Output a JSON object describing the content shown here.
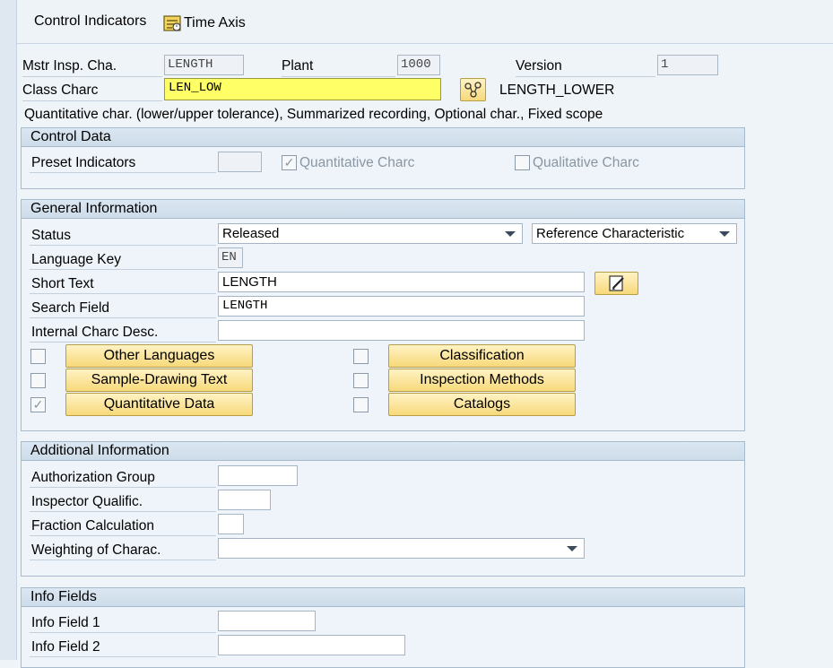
{
  "toolbar": {
    "control_indicators": "Control Indicators",
    "time_axis": "Time Axis"
  },
  "header": {
    "mstr_label": "Mstr Insp. Cha.",
    "mstr_value": "LENGTH",
    "plant_label": "Plant",
    "plant_value": "1000",
    "version_label": "Version",
    "version_value": "1",
    "class_label": "Class Charc",
    "class_value": "LEN_LOW",
    "class_desc": "LENGTH_LOWER",
    "summary": "Quantitative char. (lower/upper tolerance), Summarized recording, Optional char., Fixed scope"
  },
  "control_data": {
    "title": "Control Data",
    "preset_label": "Preset Indicators",
    "preset_value": "",
    "quant_label": "Quantitative Charc",
    "quant_checked": true,
    "qual_label": "Qualitative Charc",
    "qual_checked": false
  },
  "general": {
    "title": "General Information",
    "status_label": "Status",
    "status_value": "Released",
    "ref_value": "Reference Characteristic",
    "lang_label": "Language Key",
    "lang_value": "EN",
    "short_label": "Short Text",
    "short_value": "LENGTH",
    "search_label": "Search Field",
    "search_value": "LENGTH",
    "internal_label": "Internal Charc Desc.",
    "internal_value": "",
    "buttons": {
      "other_languages": "Other Languages",
      "sample_drawing": "Sample-Drawing Text",
      "quantitative": "Quantitative Data",
      "classification": "Classification",
      "inspection_methods": "Inspection Methods",
      "catalogs": "Catalogs"
    }
  },
  "additional": {
    "title": "Additional Information",
    "auth_label": "Authorization Group",
    "inspector_label": "Inspector Qualific.",
    "fraction_label": "Fraction Calculation",
    "weighting_label": "Weighting of Charac."
  },
  "info": {
    "title": "Info Fields",
    "field1_label": "Info Field 1",
    "field2_label": "Info Field 2"
  },
  "icons": {
    "time_axis": "time-axis-icon",
    "class_lookup": "hierarchy-icon",
    "edit_text": "pencil-icon"
  }
}
